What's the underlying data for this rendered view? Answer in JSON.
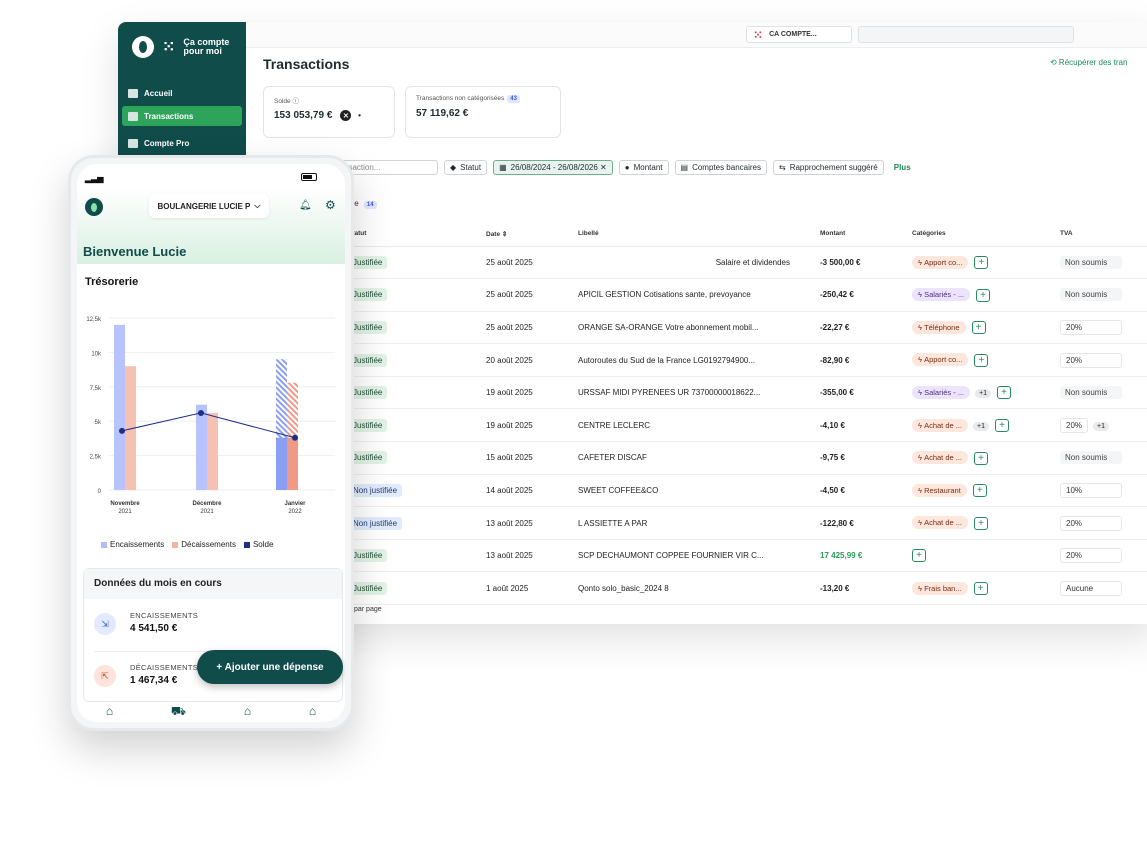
{
  "colors": {
    "brand": "#0f4c4a",
    "accent": "#2ea35a",
    "encaissements": "#aebdfa",
    "decaissements": "#f2b4a4",
    "solde": "#1e2f8a"
  },
  "desktop": {
    "sidebar": {
      "logo_text_1": "Ça compte",
      "logo_text_2": "pour moi",
      "items": [
        {
          "label": "Accueil",
          "icon": "dashboard-icon"
        },
        {
          "label": "Transactions",
          "icon": "bank-icon"
        },
        {
          "label": "Compte Pro",
          "icon": "card-icon"
        }
      ]
    },
    "topbar": {
      "account_label": "CA COMPTE..."
    },
    "page_title": "Transactions",
    "recover_label": "⟲ Récupérer des tran",
    "cards": [
      {
        "label": "Solde",
        "value": "153 053,79 €"
      },
      {
        "label": "Transactions non catégorisées",
        "badge": "43",
        "value": "57 119,62 €"
      }
    ],
    "filters": {
      "search_placeholder": "nsaction...",
      "chips": [
        "Statut",
        "26/08/2024 - 26/08/2026 ✕",
        "Montant",
        "Comptes bancaires",
        "Rapprochement suggéré"
      ],
      "more": "Plus"
    },
    "tab": {
      "label": "iée",
      "count": "14"
    },
    "table": {
      "headers": [
        "Statut",
        "Date",
        "Libellé",
        "Montant",
        "Catégories",
        "TVA"
      ],
      "rows": [
        {
          "status": "Justifiée",
          "date": "25 août 2025",
          "label": "Salaire et dividendes",
          "amount": "-3 500,00 €",
          "category": "Apport co...",
          "tva": "Non soumis"
        },
        {
          "status": "Justifiée",
          "date": "25 août 2025",
          "label": "APICIL GESTION Cotisations sante, prevoyance",
          "amount": "-250,42 €",
          "category": "Salariés - ...",
          "tva": "Non soumis"
        },
        {
          "status": "Justifiée",
          "date": "25 août 2025",
          "label": "ORANGE SA-ORANGE Votre abonnement mobil...",
          "amount": "-22,27 €",
          "category": "Téléphone",
          "tva": "20%"
        },
        {
          "status": "Justifiée",
          "date": "20 août 2025",
          "label": "Autoroutes du Sud de la France LG0192794900...",
          "amount": "-82,90 €",
          "category": "Apport co...",
          "tva": "20%"
        },
        {
          "status": "Justifiée",
          "date": "19 août 2025",
          "label": "URSSAF MIDI PYRENEES UR 73700000018622...",
          "amount": "-355,00 €",
          "category": "Salariés - ...",
          "extra": "+1",
          "tva": "Non soumis"
        },
        {
          "status": "Justifiée",
          "date": "19 août 2025",
          "label": "CENTRE LECLERC",
          "amount": "-4,10 €",
          "category": "Achat de ...",
          "extra": "+1",
          "tva": "20%",
          "tva_extra": "+1"
        },
        {
          "status": "Justifiée",
          "date": "15 août 2025",
          "label": "CAFETER DISCAF",
          "amount": "-9,75 €",
          "category": "Achat de ...",
          "tva": "Non soumis"
        },
        {
          "status": "Non justifiée",
          "date": "14 août 2025",
          "label": "SWEET COFFEE&CO",
          "amount": "-4,50 €",
          "category": "Restaurant",
          "tva": "10%"
        },
        {
          "status": "Non justifiée",
          "date": "13 août 2025",
          "label": "L ASSIETTE A PAR",
          "amount": "-122,80 €",
          "category": "Achat de ...",
          "tva": "20%"
        },
        {
          "status": "Justifiée",
          "date": "13 août 2025",
          "label": "SCP DECHAUMONT COPPEE FOURNIER VIR C...",
          "amount": "17 425,99 €",
          "category": "",
          "tva": "20%"
        },
        {
          "status": "Justifiée",
          "date": "1 août 2025",
          "label": "Qonto solo_basic_2024 8",
          "amount": "-13,20 €",
          "category": "Frais ban...",
          "tva": "Aucune"
        }
      ]
    },
    "per_page": "par page"
  },
  "phone": {
    "company": "BOULANGERIE LUCIE P",
    "welcome": "Bienvenue Lucie",
    "treso_title": "Trésorerie",
    "legend": [
      "Encaissements",
      "Décaissements",
      "Solde"
    ],
    "month_title": "Données du mois en cours",
    "encaissements_label": "ENCAISSEMENTS",
    "encaissements_value": "4 541,50 €",
    "decaissements_label": "DÉCAISSEMENTS",
    "decaissements_value": "1 467,34 €",
    "fab_label": "+ Ajouter une dépense"
  },
  "chart_data": {
    "type": "bar",
    "title": "Trésorerie",
    "categories": [
      [
        "Novembre",
        "2021"
      ],
      [
        "Décembre",
        "2021"
      ],
      [
        "Janvier",
        "2022"
      ]
    ],
    "series": [
      {
        "name": "Encaissements",
        "values": [
          12000,
          6200,
          9500
        ]
      },
      {
        "name": "Décaissements",
        "values": [
          9000,
          5600,
          7800
        ]
      },
      {
        "name": "Solde",
        "values": [
          4300,
          5600,
          3800
        ],
        "type": "line"
      }
    ],
    "ylim": [
      0,
      12500
    ],
    "yticks": [
      0,
      2500,
      5000,
      7500,
      10000,
      12500
    ],
    "ytick_labels": [
      "0",
      "2,5k",
      "5k",
      "7,5k",
      "10k",
      "12,5k"
    ]
  }
}
